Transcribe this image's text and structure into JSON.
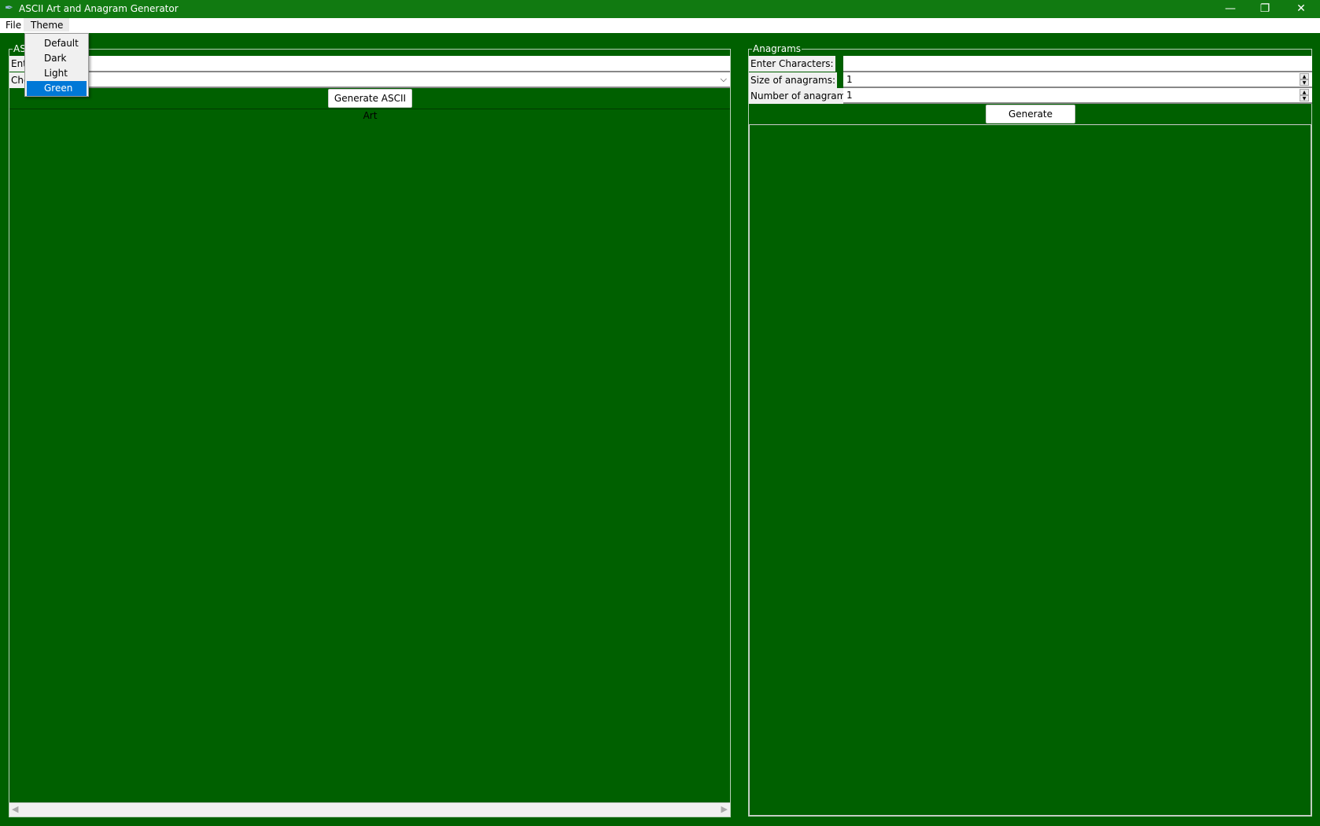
{
  "window": {
    "title": "ASCII Art and Anagram Generator",
    "icon": "feather-icon"
  },
  "menubar": {
    "items": [
      "File",
      "Theme"
    ]
  },
  "theme_menu": {
    "items": [
      "Default",
      "Dark",
      "Light",
      "Green"
    ],
    "selected": "Green"
  },
  "ascii": {
    "legend": "ASCII Art",
    "enter_label": "Ent",
    "choose_label": "Cho",
    "text_value": "",
    "font_value": "",
    "generate_label": "Generate ASCII Art"
  },
  "anagrams": {
    "legend": "Anagrams",
    "chars_label": "Enter Characters:",
    "chars_value": "",
    "size_label": "Size of anagrams:",
    "size_value": "1",
    "number_label": "Number of anagrams:",
    "number_value": "1",
    "generate_label": "Generate Anagrams"
  },
  "colors": {
    "titlebar": "#117a11",
    "background": "#006000",
    "highlight": "#0078d7"
  }
}
